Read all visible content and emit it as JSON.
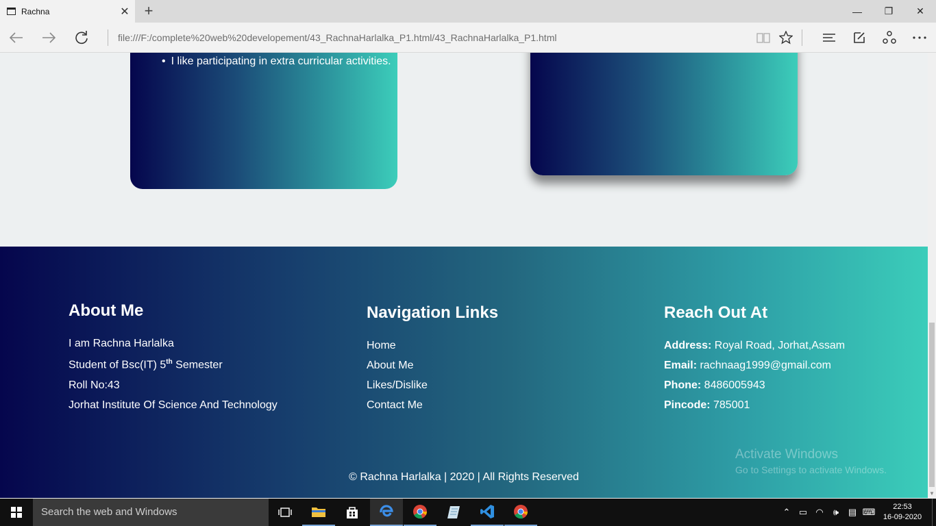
{
  "browser": {
    "tab_title": "Rachna",
    "tab_close": "✕",
    "new_tab": "+",
    "url": "file:///F:/complete%20web%20developement/43_RachnaHarlalka_P1.html/43_RachnaHarlalka_P1.html",
    "window_minimize": "—",
    "window_restore": "❐",
    "window_close": "✕"
  },
  "page": {
    "card_bullet": "I like participating in extra curricular activities.",
    "footer": {
      "about": {
        "heading": "About Me",
        "name": "I am Rachna Harlalka",
        "student_prefix": "Student of Bsc(IT) 5",
        "student_sup": "th",
        "student_suffix": " Semester",
        "roll": "Roll No:43",
        "institute": "Jorhat Institute Of Science And Technology"
      },
      "nav": {
        "heading": "Navigation Links",
        "links": [
          "Home",
          "About Me",
          "Likes/Dislike",
          "Contact Me"
        ]
      },
      "reach": {
        "heading": "Reach Out At",
        "address_label": "Address:",
        "address_value": " Royal Road, Jorhat,Assam",
        "email_label": "Email:",
        "email_value": " rachnaag1999@gmail.com",
        "phone_label": "Phone:",
        "phone_value": " 8486005943",
        "pincode_label": "Pincode:",
        "pincode_value": " 785001"
      },
      "copyright": "© Rachna Harlalka | 2020 | All Rights Reserved"
    },
    "watermark_line1": "Activate Windows",
    "watermark_line2": "Go to Settings to activate Windows."
  },
  "taskbar": {
    "search_placeholder": "Search the web and Windows",
    "time": "22:53",
    "date": "16-09-2020",
    "icons": [
      "task-view-icon",
      "file-explorer-icon",
      "store-icon",
      "edge-icon",
      "chrome-icon",
      "notepad-icon",
      "vscode-icon",
      "chrome-icon"
    ]
  },
  "colors": {
    "gradient_start": "#05064d",
    "gradient_end": "#3ccdba",
    "page_bg": "#edf0f1",
    "taskbar_bg": "#101010"
  }
}
